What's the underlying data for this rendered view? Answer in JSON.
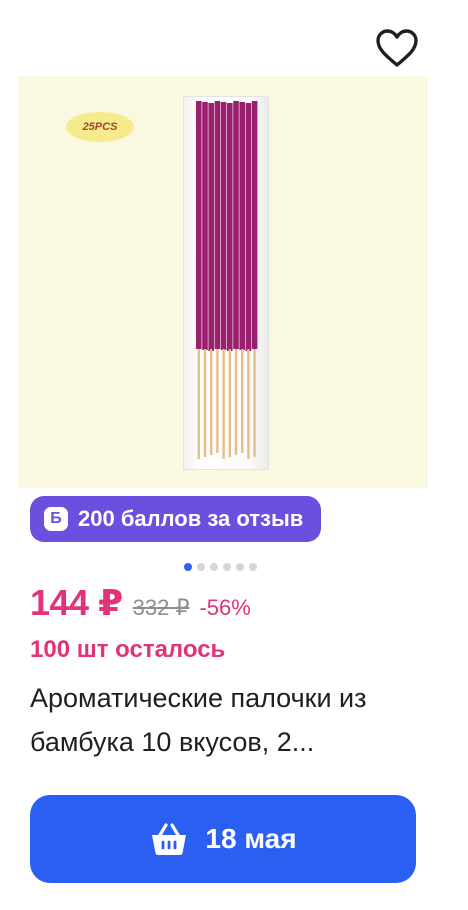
{
  "product": {
    "image_badge": "25PCS",
    "points_badge": {
      "icon_letter": "Б",
      "text": "200 баллов за отзыв"
    },
    "carousel": {
      "count": 6,
      "active_index": 0
    },
    "price": {
      "current": "144 ₽",
      "old": "332 ₽",
      "discount": "-56%"
    },
    "stock_text": "100 шт осталось",
    "title": "Ароматические палочки из бамбука 10 вкусов, 2...",
    "cart_button": {
      "icon": "basket-icon",
      "label": "18 мая"
    }
  },
  "colors": {
    "accent_pink": "#e0337b",
    "points_purple": "#6d4fe0",
    "button_blue": "#2a5ff2",
    "stick_purple": "#9a1f6e",
    "stick_bamboo": "#e3c08a",
    "image_background": "#fbf8e2"
  }
}
